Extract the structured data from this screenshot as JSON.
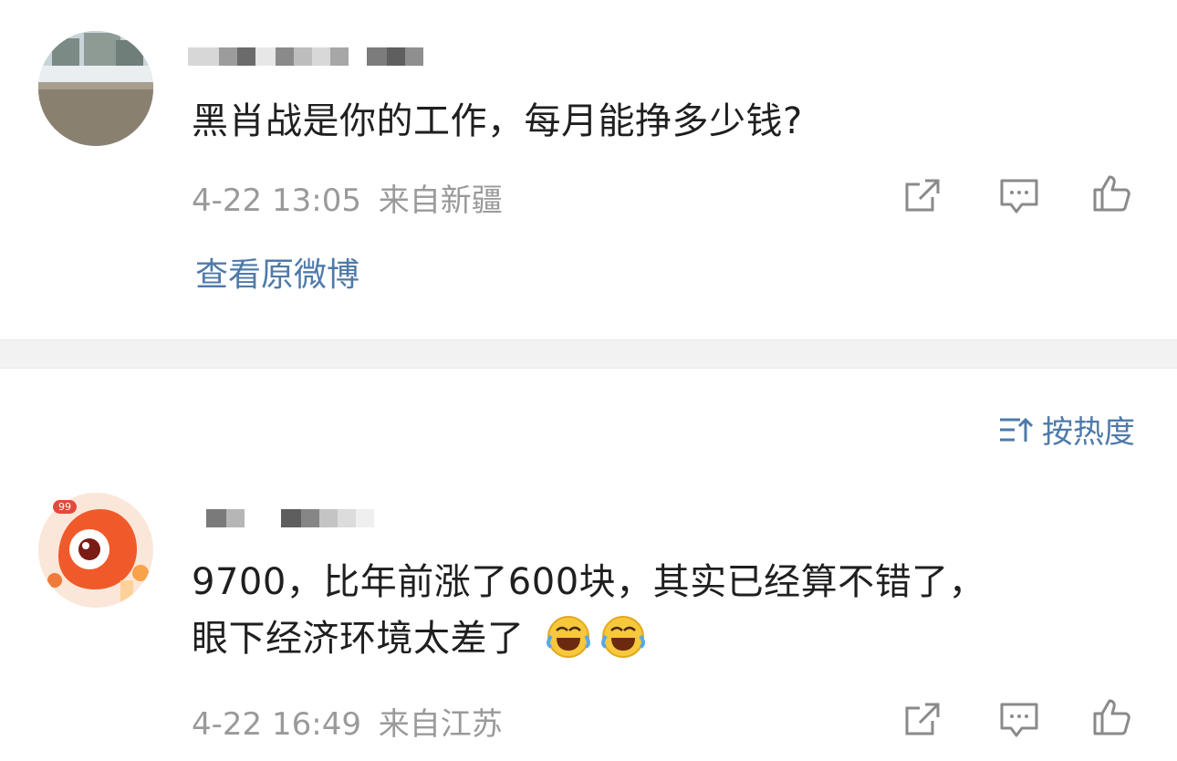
{
  "comments": [
    {
      "text": "黑肖战是你的工作，每月能挣多少钱?",
      "time": "4-22 13:05",
      "location": "来自新疆",
      "view_original": "查看原微博"
    },
    {
      "text_line1": "9700，比年前涨了600块，其实已经算不错了，",
      "text_line2": "眼下经济环境太差了",
      "time": "4-22 16:49",
      "location": "来自江苏",
      "avatar_badge": "99",
      "emojis": [
        "laugh-cry-emoji",
        "laugh-cry-emoji"
      ]
    }
  ],
  "sort": {
    "label": "按热度",
    "icon": "sort-icon"
  },
  "actions": [
    "share-icon",
    "comment-icon",
    "like-icon"
  ],
  "colors": {
    "link": "#4f7aa8",
    "meta": "#9a9a9a",
    "text": "#1f1f1f",
    "band": "#f2f2f2"
  }
}
